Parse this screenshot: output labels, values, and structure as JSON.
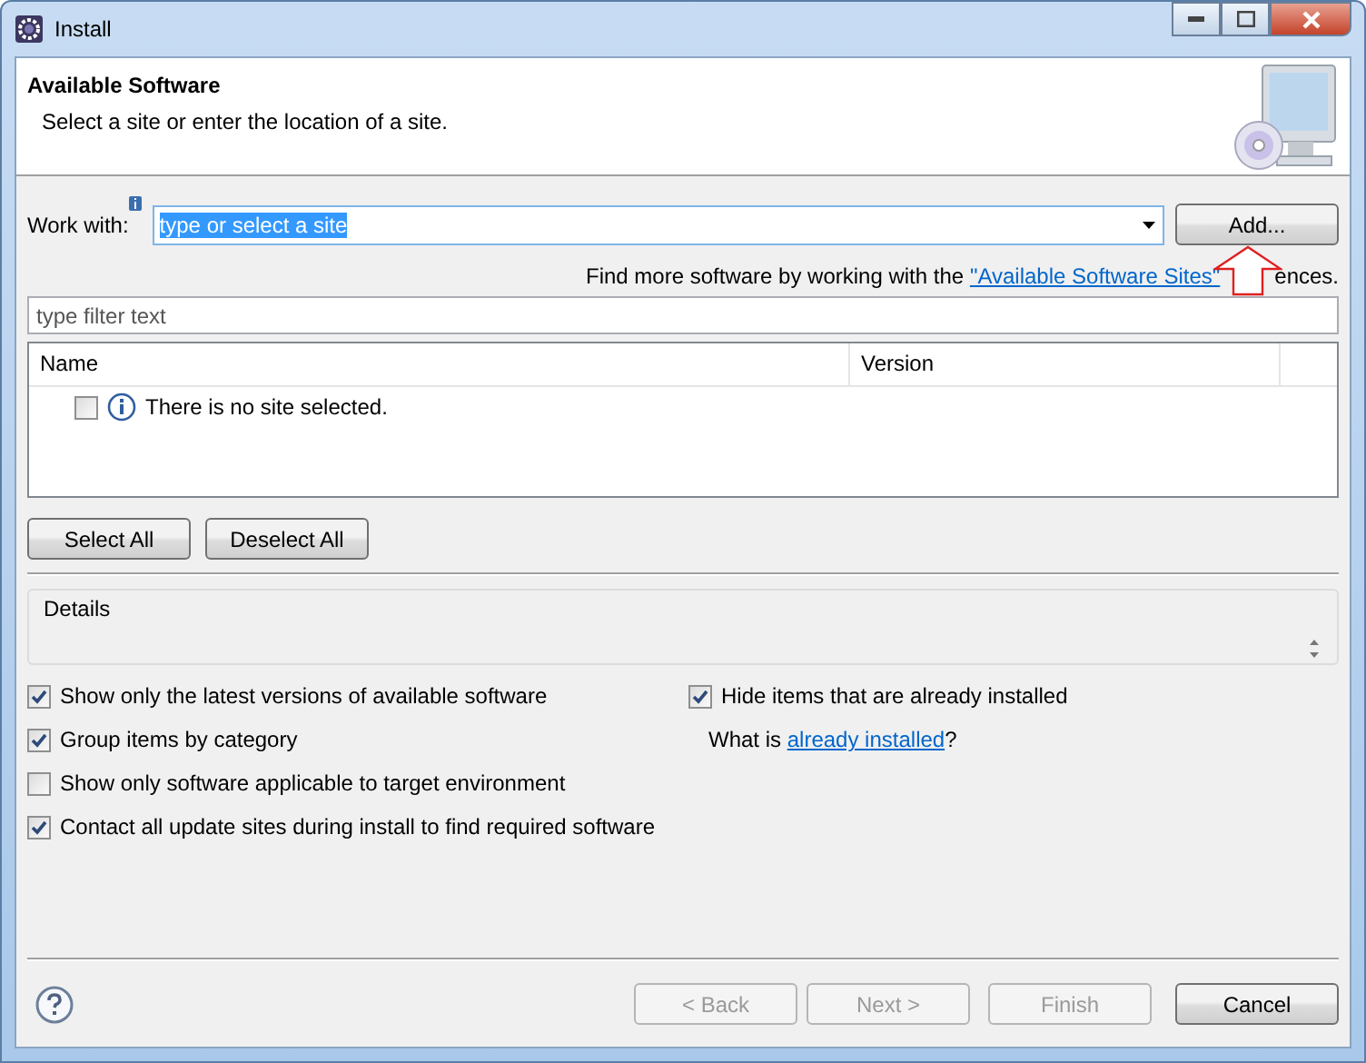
{
  "window": {
    "title": "Install"
  },
  "header": {
    "title": "Available Software",
    "subtitle": "Select a site or enter the location of a site."
  },
  "work_with": {
    "label": "Work with:",
    "value": "type or select a site",
    "text_selected": true,
    "add_button": "Add..."
  },
  "find_more": {
    "prefix": "Find more software by working with the",
    "link": "\"Available Software Sites\"",
    "suffix": "ences."
  },
  "filter": {
    "placeholder": "type filter text"
  },
  "table": {
    "columns": [
      "Name",
      "Version"
    ],
    "rows": [
      {
        "name": "There is no site selected.",
        "checked": false
      }
    ]
  },
  "selection_buttons": [
    "Select All",
    "Deselect All"
  ],
  "details": {
    "label": "Details"
  },
  "options_left": [
    {
      "label": "Show only the latest versions of available software",
      "checked": true
    },
    {
      "label": "Group items by category",
      "checked": true
    },
    {
      "label": "Show only software applicable to target environment",
      "checked": false
    },
    {
      "label": "Contact all update sites during install to find required software",
      "checked": true
    }
  ],
  "options_right": {
    "hide": {
      "label": "Hide items that are already installed",
      "checked": true
    },
    "what_is": {
      "prefix": "What is",
      "link": "already installed",
      "suffix": "?"
    }
  },
  "footer_buttons": [
    {
      "label": "< Back",
      "disabled": true
    },
    {
      "label": "Next >",
      "disabled": true
    },
    {
      "label": "Finish",
      "disabled": true
    },
    {
      "label": "Cancel",
      "disabled": false
    }
  ]
}
